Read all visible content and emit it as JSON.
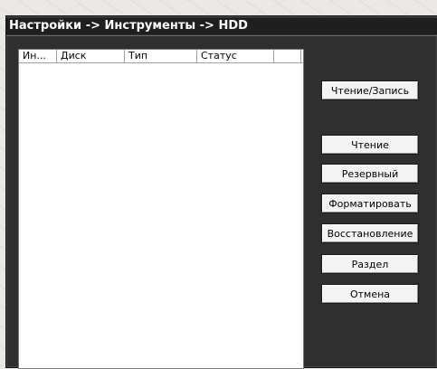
{
  "window": {
    "title": "Настройки -> Инструменты -> HDD"
  },
  "table": {
    "columns": [
      "Ин...",
      "Диск",
      "Тип",
      "Статус",
      ""
    ],
    "rows": []
  },
  "buttons": {
    "read_write": "Чтение/Запись",
    "read": "Чтение",
    "reserve": "Резервный",
    "format": "Форматировать",
    "restore": "Восстановление",
    "partition": "Раздел",
    "cancel": "Отмена"
  }
}
